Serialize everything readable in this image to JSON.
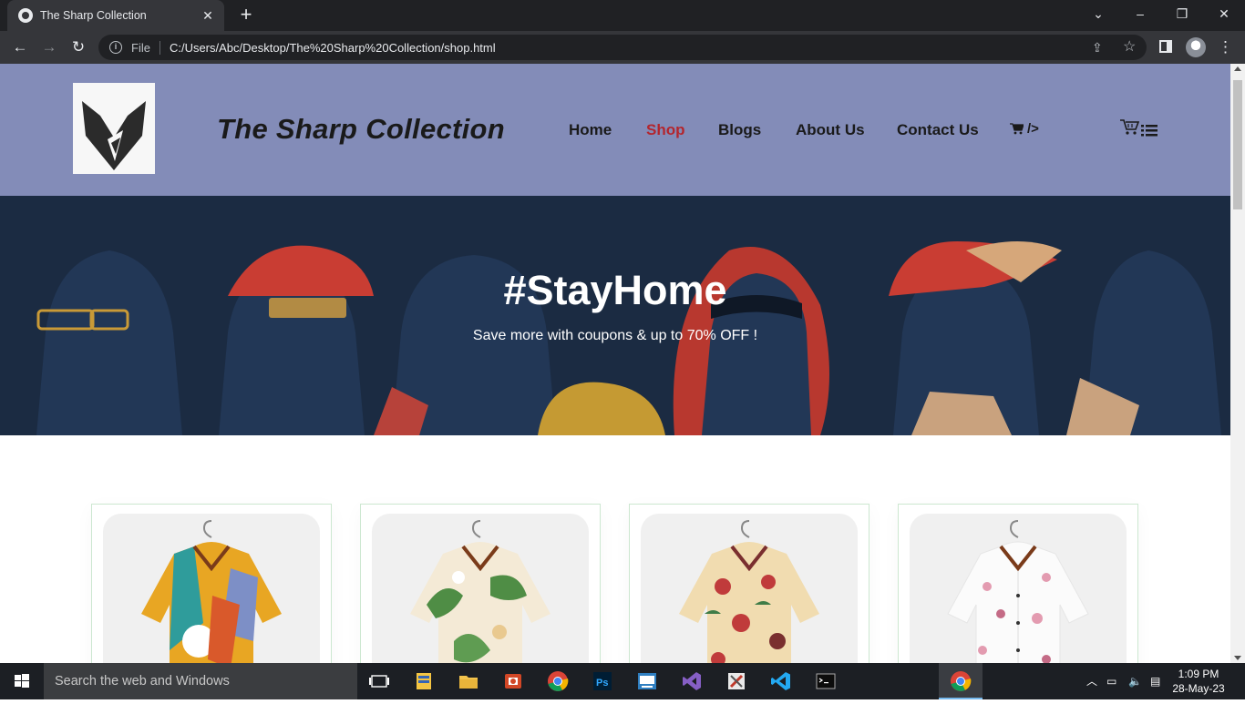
{
  "browser": {
    "tab_title": "The Sharp Collection",
    "tab_close": "✕",
    "new_tab": "+",
    "window_controls": {
      "dropdown": "⌄",
      "minimize": "–",
      "restore": "❐",
      "close": "✕"
    },
    "nav": {
      "back": "←",
      "forward": "→",
      "reload": "↻"
    },
    "file_label": "File",
    "url": "C:/Users/Abc/Desktop/The%20Sharp%20Collection/shop.html",
    "share_glyph": "⇪",
    "star_glyph": "☆",
    "menu_glyph": "⋮"
  },
  "site": {
    "brand": "The Sharp Collection",
    "nav": [
      {
        "label": "Home",
        "active": false
      },
      {
        "label": "Shop",
        "active": true
      },
      {
        "label": "Blogs",
        "active": false
      },
      {
        "label": "About Us",
        "active": false
      },
      {
        "label": "Contact Us",
        "active": false
      }
    ],
    "nav_cart_text": "/>",
    "active_color": "#b3262e",
    "header_color": "#838cb8"
  },
  "hero": {
    "title": "#StayHome",
    "subtitle": "Save more with coupons & up to 70% OFF !"
  },
  "products": [
    {
      "name": "multicolor-abstract-shirt",
      "colors": [
        "#e8a623",
        "#2f9c9b",
        "#7d8fc6",
        "#ffffff"
      ]
    },
    {
      "name": "floral-leaf-shirt",
      "colors": [
        "#f4ead6",
        "#4f8d45",
        "#e9c98f",
        "#ffffff"
      ]
    },
    {
      "name": "red-floral-shirt",
      "colors": [
        "#f1dcb0",
        "#c03b3b",
        "#3f7c47",
        "#7a2f2f"
      ]
    },
    {
      "name": "pink-blossom-shirt",
      "colors": [
        "#fbfbfb",
        "#e39bb0",
        "#c46b86",
        "#ffffff"
      ]
    }
  ],
  "taskbar": {
    "search_placeholder": "Search the web and Windows",
    "time": "1:09 PM",
    "date": "28-May-23"
  }
}
